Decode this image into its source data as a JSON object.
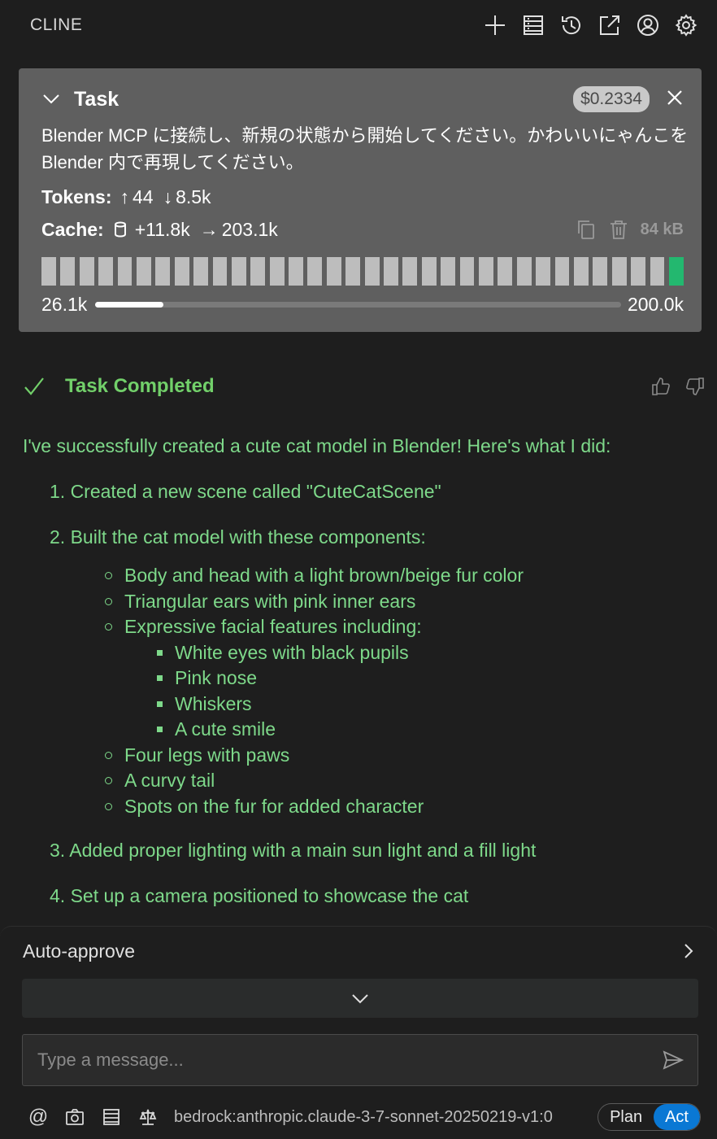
{
  "header": {
    "title": "CLINE",
    "icons": [
      "plus-icon",
      "mcp-servers-icon",
      "history-icon",
      "popout-icon",
      "account-icon",
      "settings-icon"
    ]
  },
  "task": {
    "label": "Task",
    "cost": "$0.2334",
    "text": "Blender MCP に接続し、新規の状態から開始してください。かわいいにゃんこを Blender 内で再現してください。",
    "tokens_label": "Tokens:",
    "tokens_up": "44",
    "tokens_down": "8.5k",
    "cache_label": "Cache:",
    "cache_write": "+11.8k",
    "cache_read": "203.1k",
    "size": "84 kB",
    "context_used": "26.1k",
    "context_max": "200.0k",
    "context_fraction": 0.13,
    "block_count": 34
  },
  "completion": {
    "label": "Task Completed"
  },
  "report": {
    "intro": "I've successfully created a cute cat model in Blender! Here's what I did:",
    "step1": "1. Created a new scene called \"CuteCatScene\"",
    "step2": "2. Built the cat model with these components:",
    "components": {
      "c1": "Body and head with a light brown/beige fur color",
      "c2": "Triangular ears with pink inner ears",
      "c3": "Expressive facial features including:",
      "f1": "White eyes with black pupils",
      "f2": "Pink nose",
      "f3": "Whiskers",
      "f4": "A cute smile",
      "c4": "Four legs with paws",
      "c5": "A curvy tail",
      "c6": "Spots on the fur for added character"
    },
    "step3": "3. Added proper lighting with a main sun light and a fill light",
    "step4": "4. Set up a camera positioned to showcase the cat"
  },
  "bottom": {
    "auto_approve": "Auto-approve",
    "message_placeholder": "Type a message...",
    "model": "bedrock:anthropic.claude-3-7-sonnet-20250219-v1:0",
    "mode_plan": "Plan",
    "mode_act": "Act",
    "mention_symbol": "@"
  },
  "colors": {
    "accent_green": "#7ed98a",
    "act_blue": "#0a78d4",
    "context_block_active": "#23b86f"
  }
}
